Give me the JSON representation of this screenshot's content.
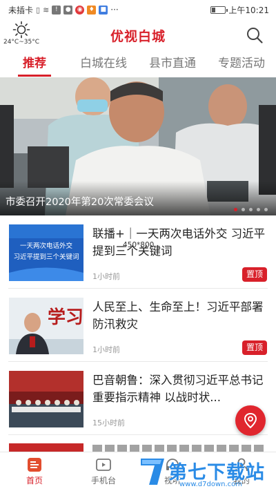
{
  "status_bar": {
    "carrier": "未插卡",
    "time": "上午10:21",
    "more": "···",
    "battery_level": 0.3
  },
  "header": {
    "title": "优视白城",
    "weather_temp": "24°C~35°C",
    "weather_icon": "sun-icon",
    "search_icon": "search-icon"
  },
  "tabs": [
    {
      "label": "推荐",
      "active": true
    },
    {
      "label": "白城在线",
      "active": false
    },
    {
      "label": "县市直通",
      "active": false
    },
    {
      "label": "专题活动",
      "active": false
    }
  ],
  "banner": {
    "caption": "市委召开2020年第20次常委会议",
    "slide_count": 5,
    "active_slide": 1
  },
  "news": [
    {
      "title": "联播+｜一天两次电话外交 习近平提到三个关键词",
      "time": "1小时前",
      "badge": "置顶",
      "thumb_line1": "一天两次电话外交",
      "thumb_line2": "习近平提到三个关键词"
    },
    {
      "title": "人民至上、生命至上！习近平部署防汛救灾",
      "time": "1小时前",
      "badge": "置顶",
      "thumb_text": "学习"
    },
    {
      "title": "巴音朝鲁：深入贯彻习近平总书记重要指示精神 以战时状...",
      "time": "15小时前"
    }
  ],
  "overlay_size": "450*800",
  "bottom_nav": [
    {
      "label": "首页",
      "icon": "home-news-icon",
      "active": true
    },
    {
      "label": "手机台",
      "icon": "tv-play-icon",
      "active": false
    },
    {
      "label": "视听",
      "icon": "headset-icon",
      "active": false
    },
    {
      "label": "我的",
      "icon": "user-icon",
      "active": false
    }
  ],
  "watermark": {
    "text": "第七下载站",
    "url": "www.d7down.com"
  },
  "colors": {
    "accent": "#d8202a",
    "watermark": "#2a8be6"
  }
}
